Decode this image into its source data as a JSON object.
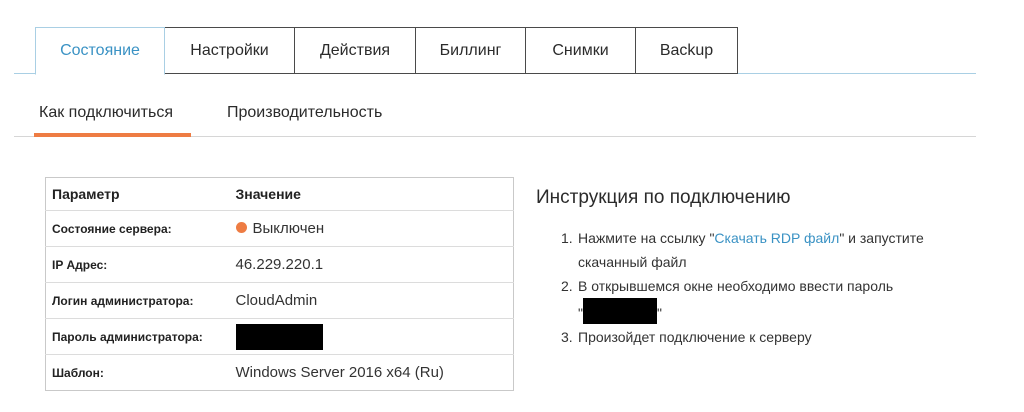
{
  "tabs": [
    "Состояние",
    "Настройки",
    "Действия",
    "Биллинг",
    "Снимки",
    "Backup"
  ],
  "subtabs": [
    "Как подключиться",
    "Производительность"
  ],
  "table": {
    "header": {
      "param": "Параметр",
      "value": "Значение"
    },
    "rows": [
      {
        "key": "Состояние сервера:",
        "value": "Выключен"
      },
      {
        "key": "IP Адрес:",
        "value": "46.229.220.1"
      },
      {
        "key": "Логин администратора:",
        "value": "CloudAdmin"
      },
      {
        "key": "Пароль администратора:",
        "value": ""
      },
      {
        "key": "Шаблон:",
        "value": "Windows Server 2016 x64 (Ru)"
      }
    ]
  },
  "instructions": {
    "title": "Инструкция по подключению",
    "step1_num": "1.",
    "step1_before": "Нажмите на ссылку \"",
    "step1_link": "Скачать RDP файл",
    "step1_after": "\" и запустите скачанный файл",
    "step2_num": "2.",
    "step2_text": "В открывшемся окне необходимо ввести пароль",
    "step2_quote_open": "\"",
    "step2_quote_close": "\"",
    "step3_num": "3.",
    "step3_text": "Произойдет подключение к серверу"
  },
  "colors": {
    "accent": "#3a92c4",
    "orange": "#ee7c43"
  }
}
